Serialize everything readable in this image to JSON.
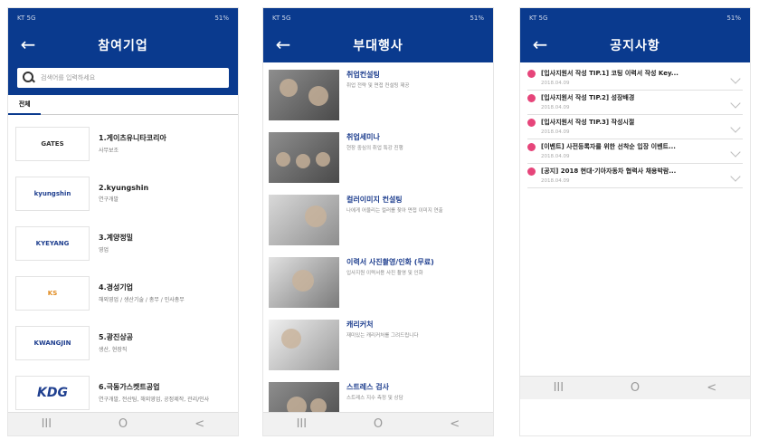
{
  "phone1": {
    "status_left": "KT 5G",
    "status_right": "51%",
    "title": "참여기업",
    "search_placeholder": "검색어를 입력하세요",
    "filter_tabs": [
      "전체",
      "",
      "",
      "",
      "",
      "",
      ""
    ],
    "companies": [
      {
        "name": "1.게이츠유니타코리아",
        "sub": "사무보조",
        "logo": "GATES"
      },
      {
        "name": "2.kyungshin",
        "sub": "연구개발",
        "logo": "kyungshin"
      },
      {
        "name": "3.계양정밀",
        "sub": "영업",
        "logo": "KYEYANG"
      },
      {
        "name": "4.경성기업",
        "sub": "해외영업 / 생산기술 / 총무 / 인사총무",
        "logo": "KS"
      },
      {
        "name": "5.광진상공",
        "sub": "생산, 현장직",
        "logo": "KWANGJIN"
      },
      {
        "name": "6.극동가스켓트공업",
        "sub": "연구개발, 전산팀, 해외영업, 공정제작, 관리/인사",
        "logo": "KDG"
      }
    ]
  },
  "phone2": {
    "status_left": "KT 5G",
    "status_right": "51%",
    "title": "부대행사",
    "events": [
      {
        "title": "취업컨설팅",
        "desc": "취업 전략 및 면접 컨설팅 제공"
      },
      {
        "title": "취업세미나",
        "desc": "현장 중심의 취업 특강 진행"
      },
      {
        "title": "컬러이미지 컨설팅",
        "desc": "나에게 어울리는 컬러를 찾아 면접 이미지 연출"
      },
      {
        "title": "이력서 사진촬영/인화 (무료)",
        "desc": "입사지원 이력서용 사진 촬영 및 인화"
      },
      {
        "title": "캐리커처",
        "desc": "재미있는 캐리커처를 그려드립니다"
      },
      {
        "title": "스트레스 검사",
        "desc": "스트레스 지수 측정 및 상담"
      }
    ]
  },
  "phone3": {
    "status_left": "KT 5G",
    "status_right": "51%",
    "title": "공지사항",
    "notices": [
      {
        "title": "[입사지원서 작성 TIP.1] 코팅 이력서 작성 Key...",
        "date": "2018.04.09"
      },
      {
        "title": "[입사지원서 작성 TIP.2] 성장배경",
        "date": "2018.04.09"
      },
      {
        "title": "[입사지원서 작성 TIP.3] 작성시절",
        "date": "2018.04.09"
      },
      {
        "title": "[이벤트] 사전등록자를 위한 선착순 입장 이벤트...",
        "date": "2018.04.09"
      },
      {
        "title": "[공지] 2018 현대·기아자동차 협력사 채용박람...",
        "date": "2018.04.09"
      }
    ]
  },
  "nav": {
    "recents": "III",
    "home": "O",
    "back": "<"
  },
  "colors": {
    "primary": "#0a3a8e",
    "accent_pink": "#e6457a",
    "event_title": "#1f3f8f"
  }
}
